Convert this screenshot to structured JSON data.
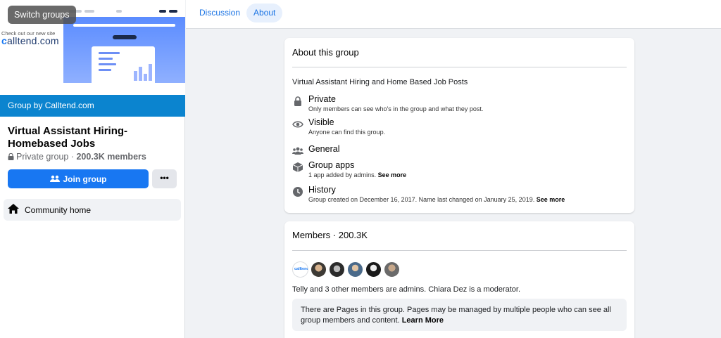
{
  "sidebar": {
    "switch_groups": "Switch groups",
    "promo_tag": "Check out our new site",
    "promo_logo_prefix": "c",
    "promo_logo_rest": "alltend.com",
    "group_by": "Group by Calltend.com",
    "group_name": "Virtual Assistant Hiring-Homebased Jobs",
    "privacy": "Private group",
    "members_count": "200.3K members",
    "join_label": "Join group",
    "more_label": "•••",
    "community_home": "Community home"
  },
  "tabs": {
    "discussion": "Discussion",
    "about": "About"
  },
  "about": {
    "heading": "About this group",
    "description": "Virtual Assistant Hiring and Home Based Job Posts",
    "items": [
      {
        "icon": "lock-icon",
        "title": "Private",
        "sub": "Only members can see who's in the group and what they post.",
        "link": ""
      },
      {
        "icon": "eye-icon",
        "title": "Visible",
        "sub": "Anyone can find this group.",
        "link": ""
      },
      {
        "icon": "people-icon",
        "title": "General",
        "sub": "",
        "link": ""
      },
      {
        "icon": "box-icon",
        "title": "Group apps",
        "sub": "1 app added by admins.",
        "link": "See more"
      },
      {
        "icon": "clock-icon",
        "title": "History",
        "sub": "Group created on December 16, 2017. Name last changed on January 25, 2019.",
        "link": "See more"
      }
    ]
  },
  "members": {
    "heading": "Members · 200.3K",
    "avatar_logo": "calltend",
    "admins_text": "Telly and 3 other members are admins. Chiara Dez is a moderator.",
    "pages_note": "There are Pages in this group. Pages may be managed by multiple people who can see all group members and content.",
    "pages_link": "Learn More"
  },
  "colors": {
    "accent": "#1877f2",
    "group_by_bar": "#0b84cf",
    "tab_text": "#1b74e4",
    "page_bg": "#f0f2f5"
  }
}
